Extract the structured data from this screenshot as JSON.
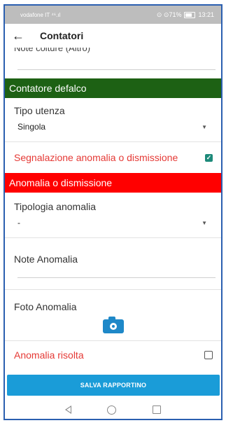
{
  "status": {
    "carrier": "vodafone IT",
    "signal": "⁴⁶.ıl",
    "right": "⊙ ⊙71%",
    "time": "13:21"
  },
  "appbar": {
    "back_glyph": "←",
    "title": "Contatori"
  },
  "form": {
    "note_colture_label": "Note colture (Altro)",
    "section_defalco": "Contatore defalco",
    "tipo_utenza_label": "Tipo utenza",
    "tipo_utenza_value": "Singola",
    "segnalazione_label": "Segnalazione anomalia o dismissione",
    "section_anomalia": "Anomalia o dismissione",
    "tipologia_label": "Tipologia anomalia",
    "tipologia_value": "-",
    "note_anomalia_label": "Note Anomalia",
    "foto_label": "Foto Anomalia",
    "anomalia_risolta_label": "Anomalia risolta",
    "save_label": "SALVA RAPPORTINO",
    "checkbox_segnalazione": true,
    "checkbox_risolta": false
  },
  "colors": {
    "green_section": "#1d6114",
    "red_section": "#ff0000",
    "accent_blue": "#1a9cd8",
    "teal_check": "#1d8a7a"
  }
}
